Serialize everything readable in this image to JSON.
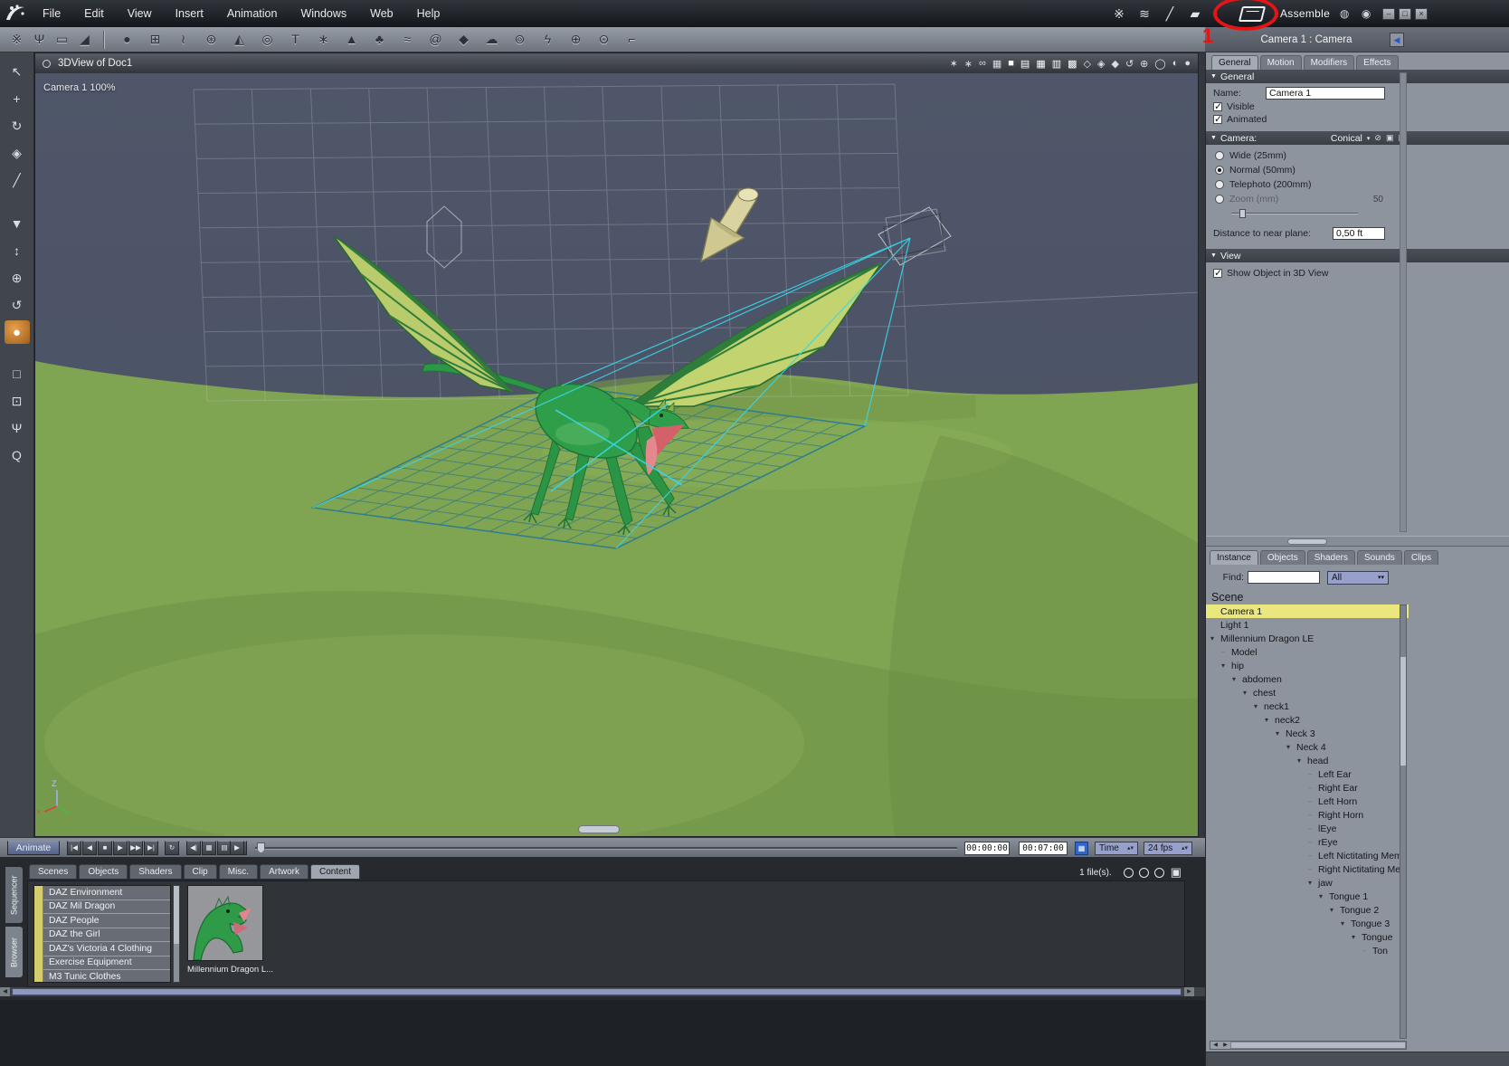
{
  "colors": {
    "annotation": "#e51515",
    "selection": "#e9e77e",
    "dropdown": "#96a0cb",
    "frustum": "#3ad6e8",
    "dragon": "#2f9e4a",
    "terrain": "#7fa452",
    "active_tool": "#e8a04c"
  },
  "annotation": {
    "step_label": "1"
  },
  "menu_bar": {
    "items": [
      {
        "label": "File"
      },
      {
        "label": "Edit"
      },
      {
        "label": "View"
      },
      {
        "label": "Insert"
      },
      {
        "label": "Animation"
      },
      {
        "label": "Windows"
      },
      {
        "label": "Web"
      },
      {
        "label": "Help"
      }
    ],
    "tool_icons": [
      {
        "name": "spray-brush-icon",
        "glyph": "※"
      },
      {
        "name": "airbrush-icon",
        "glyph": "≋"
      },
      {
        "name": "pen-icon",
        "glyph": "╱"
      },
      {
        "name": "marker-icon",
        "glyph": "▰"
      }
    ],
    "room_label": "Assemble",
    "aux_icons": [
      {
        "name": "globe-icon",
        "glyph": "◍"
      },
      {
        "name": "eye-icon",
        "glyph": "◉"
      }
    ],
    "window_buttons": [
      {
        "name": "minimize-button",
        "glyph": "–"
      },
      {
        "name": "maximize-button",
        "glyph": "□"
      },
      {
        "name": "close-button",
        "glyph": "×"
      }
    ]
  },
  "insert_toolbar": {
    "left_icons": [
      {
        "name": "paint-tool-icon",
        "glyph": "※"
      },
      {
        "name": "hand-tool-icon",
        "glyph": "Ψ"
      },
      {
        "name": "eraser-tool-icon",
        "glyph": "▭"
      },
      {
        "name": "trowel-tool-icon",
        "glyph": "◢"
      }
    ],
    "object_icons": [
      {
        "name": "sphere-primitive-icon",
        "glyph": "●"
      },
      {
        "name": "vertex-object-icon",
        "glyph": "⊞"
      },
      {
        "name": "spline-object-icon",
        "glyph": "≀"
      },
      {
        "name": "metaball-icon",
        "glyph": "⊛"
      },
      {
        "name": "cone-primitive-icon",
        "glyph": "◭"
      },
      {
        "name": "torus-primitive-icon",
        "glyph": "◎"
      },
      {
        "name": "text-object-icon",
        "glyph": "T"
      },
      {
        "name": "particle-emitter-icon",
        "glyph": "∗"
      },
      {
        "name": "terrain-object-icon",
        "glyph": "▲"
      },
      {
        "name": "plant-object-icon",
        "glyph": "♣"
      },
      {
        "name": "ocean-object-icon",
        "glyph": "≈"
      },
      {
        "name": "shell-object-icon",
        "glyph": "@"
      },
      {
        "name": "rock-object-icon",
        "glyph": "◆"
      },
      {
        "name": "cloud-object-icon",
        "glyph": "☁"
      },
      {
        "name": "metacloud-object-icon",
        "glyph": "⊚"
      },
      {
        "name": "lightning-object-icon",
        "glyph": "ϟ"
      },
      {
        "name": "axis-helper-icon",
        "glyph": "⊕"
      },
      {
        "name": "target-helper-icon",
        "glyph": "⊙"
      },
      {
        "name": "bone-object-icon",
        "glyph": "⌐"
      }
    ]
  },
  "left_toolbar": {
    "tools": [
      {
        "name": "select-tool-icon",
        "glyph": "↖"
      },
      {
        "name": "move-tool-icon",
        "glyph": "+"
      },
      {
        "name": "rotate-tool-icon",
        "glyph": "↻"
      },
      {
        "name": "scale-tool-icon",
        "glyph": "◈"
      },
      {
        "name": "eyedropper-tool-icon",
        "glyph": "╱"
      },
      {
        "name": "paint-fill-tool-icon",
        "glyph": "▼"
      },
      {
        "name": "pan-camera-tool-icon",
        "glyph": "↕"
      },
      {
        "name": "translate-camera-tool-icon",
        "glyph": "⊕"
      },
      {
        "name": "orbit-camera-tool-icon",
        "glyph": "↺"
      },
      {
        "name": "trackball-tool-icon",
        "glyph": "●",
        "active": true
      },
      {
        "name": "bank-camera-tool-icon",
        "glyph": "□"
      },
      {
        "name": "camera-tool-icon",
        "glyph": "⊡"
      },
      {
        "name": "pan-hand-tool-icon",
        "glyph": "Ψ"
      },
      {
        "name": "zoom-tool-icon",
        "glyph": "Q"
      }
    ]
  },
  "viewport": {
    "title": "3DView of Doc1",
    "camera_label": "Camera 1 100%",
    "axis_label": "Z",
    "titlebar_icons": [
      {
        "name": "render-preview-icon",
        "glyph": "✶"
      },
      {
        "name": "snap-icon",
        "glyph": "∗"
      },
      {
        "name": "binoculars-icon",
        "glyph": "∞"
      },
      {
        "name": "grid-settings-icon",
        "glyph": "▦"
      },
      {
        "name": "solid-view-button",
        "glyph": "■",
        "bright": true
      },
      {
        "name": "lines-view-button",
        "glyph": "▤",
        "bright": true
      },
      {
        "name": "grid-view-button",
        "glyph": "▦",
        "bright": true
      },
      {
        "name": "split-view-button",
        "glyph": "▥",
        "bright": true
      },
      {
        "name": "quad-view-button",
        "glyph": "▩",
        "bright": true
      },
      {
        "name": "production-frame-icon",
        "glyph": "◇"
      },
      {
        "name": "safe-frame-icon",
        "glyph": "◈"
      },
      {
        "name": "camera-frame-icon",
        "glyph": "◆"
      },
      {
        "name": "reset-view-icon",
        "glyph": "↺"
      },
      {
        "name": "axis-display-icon",
        "glyph": "⊕"
      },
      {
        "name": "wireframe-ball-icon",
        "glyph": "◯"
      },
      {
        "name": "shaded-ball-icon",
        "glyph": "◐"
      },
      {
        "name": "textured-ball-icon",
        "glyph": "●"
      }
    ]
  },
  "timeline": {
    "animate_label": "Animate",
    "transport": [
      {
        "name": "go-to-start-button",
        "glyph": "|◀"
      },
      {
        "name": "previous-frame-button",
        "glyph": "◀"
      },
      {
        "name": "stop-button",
        "glyph": "■"
      },
      {
        "name": "play-button",
        "glyph": "▶"
      },
      {
        "name": "next-frame-button",
        "glyph": "▶▶"
      },
      {
        "name": "go-to-end-button",
        "glyph": "▶|"
      }
    ],
    "loop_button": {
      "name": "loop-button",
      "glyph": "↻"
    },
    "key_buttons": [
      {
        "name": "previous-keyframe-button",
        "glyph": "◀|"
      },
      {
        "name": "add-keyframe-button",
        "glyph": "▦"
      },
      {
        "name": "delete-keyframe-button",
        "glyph": "▤"
      },
      {
        "name": "next-keyframe-button",
        "glyph": "|▶"
      }
    ],
    "play-range_button": {
      "name": "play-range-button",
      "glyph": "▶"
    },
    "current_time": "00:00:00",
    "end_time": "00:07:00",
    "options_glyph": "▦",
    "time_mode": "Time",
    "fps": "24 fps"
  },
  "browser": {
    "side_tabs": [
      {
        "label": "Sequencer",
        "active": false
      },
      {
        "label": "Browser",
        "active": true
      }
    ],
    "tabs": [
      {
        "label": "Scenes"
      },
      {
        "label": "Objects"
      },
      {
        "label": "Shaders"
      },
      {
        "label": "Clip"
      },
      {
        "label": "Misc."
      },
      {
        "label": "Artwork"
      },
      {
        "label": "Content",
        "active": true
      }
    ],
    "file_count": "1 file(s).",
    "view_buttons": [
      {
        "name": "view-option-1-button"
      },
      {
        "name": "view-option-2-button"
      },
      {
        "name": "view-option-3-button"
      }
    ],
    "card_icon_glyph": "▣",
    "folders": [
      {
        "label": "DAZ Environment"
      },
      {
        "label": "DAZ Mil Dragon"
      },
      {
        "label": "DAZ People"
      },
      {
        "label": "DAZ the Girl"
      },
      {
        "label": "DAZ's Victoria 4 Clothing"
      },
      {
        "label": "Exercise Equipment"
      },
      {
        "label": "M3 Tunic Clothes"
      }
    ],
    "thumbnail_caption": "Millennium Dragon L..."
  },
  "properties": {
    "title": "Camera 1 : Camera",
    "tabs": [
      {
        "label": "General",
        "active": true
      },
      {
        "label": "Motion"
      },
      {
        "label": "Modifiers"
      },
      {
        "label": "Effects"
      }
    ],
    "general_header": "General",
    "name_label": "Name:",
    "name_value": "Camera 1",
    "flags": [
      {
        "label": "Visible",
        "checked": true
      },
      {
        "label": "Animated",
        "checked": true
      }
    ],
    "camera_header": "Camera:",
    "camera_type": "Conical",
    "camera_header_icons": [
      {
        "name": "shader-link-icon",
        "glyph": "⊘"
      },
      {
        "name": "save-preset-icon",
        "glyph": "▣"
      },
      {
        "name": "load-preset-icon",
        "glyph": "▤"
      }
    ],
    "lens_options": [
      {
        "label": "Wide (25mm)"
      },
      {
        "label": "Normal (50mm)",
        "selected": true
      },
      {
        "label": "Telephoto (200mm)"
      },
      {
        "label": "Zoom (mm)"
      }
    ],
    "zoom_value": "50",
    "near_plane_label": "Distance to near plane:",
    "near_plane_value": "0,50 ft",
    "view_header": "View",
    "view_flags": [
      {
        "label": "Show Object in 3D View",
        "checked": true
      }
    ]
  },
  "scene_tree": {
    "tabs": [
      {
        "label": "Instance",
        "active": true
      },
      {
        "label": "Objects"
      },
      {
        "label": "Shaders"
      },
      {
        "label": "Sounds"
      },
      {
        "label": "Clips"
      }
    ],
    "find_label": "Find:",
    "find_value": "",
    "filter_value": "All",
    "header": "Scene",
    "nodes": [
      {
        "label": "Camera 1",
        "depth": 0,
        "selected": true
      },
      {
        "label": "Light 1",
        "depth": 0
      },
      {
        "label": "Millennium Dragon LE",
        "depth": 0
      },
      {
        "label": "Model",
        "depth": 1
      },
      {
        "label": "hip",
        "depth": 1
      },
      {
        "label": "abdomen",
        "depth": 2
      },
      {
        "label": "chest",
        "depth": 3
      },
      {
        "label": "neck1",
        "depth": 4
      },
      {
        "label": "neck2",
        "depth": 5
      },
      {
        "label": "Neck 3",
        "depth": 6
      },
      {
        "label": "Neck 4",
        "depth": 7
      },
      {
        "label": "head",
        "depth": 8
      },
      {
        "label": "Left Ear",
        "depth": 9
      },
      {
        "label": "Right Ear",
        "depth": 9
      },
      {
        "label": "Left Horn",
        "depth": 9
      },
      {
        "label": "Right Horn",
        "depth": 9
      },
      {
        "label": "lEye",
        "depth": 9
      },
      {
        "label": "rEye",
        "depth": 9
      },
      {
        "label": "Left Nictitating Mem",
        "depth": 9
      },
      {
        "label": "Right Nictitating Me",
        "depth": 9
      },
      {
        "label": "jaw",
        "depth": 9
      },
      {
        "label": "Tongue 1",
        "depth": 10
      },
      {
        "label": "Tongue 2",
        "depth": 11
      },
      {
        "label": "Tongue 3",
        "depth": 12
      },
      {
        "label": "Tongue",
        "depth": 13
      },
      {
        "label": "Ton",
        "depth": 14
      }
    ]
  }
}
